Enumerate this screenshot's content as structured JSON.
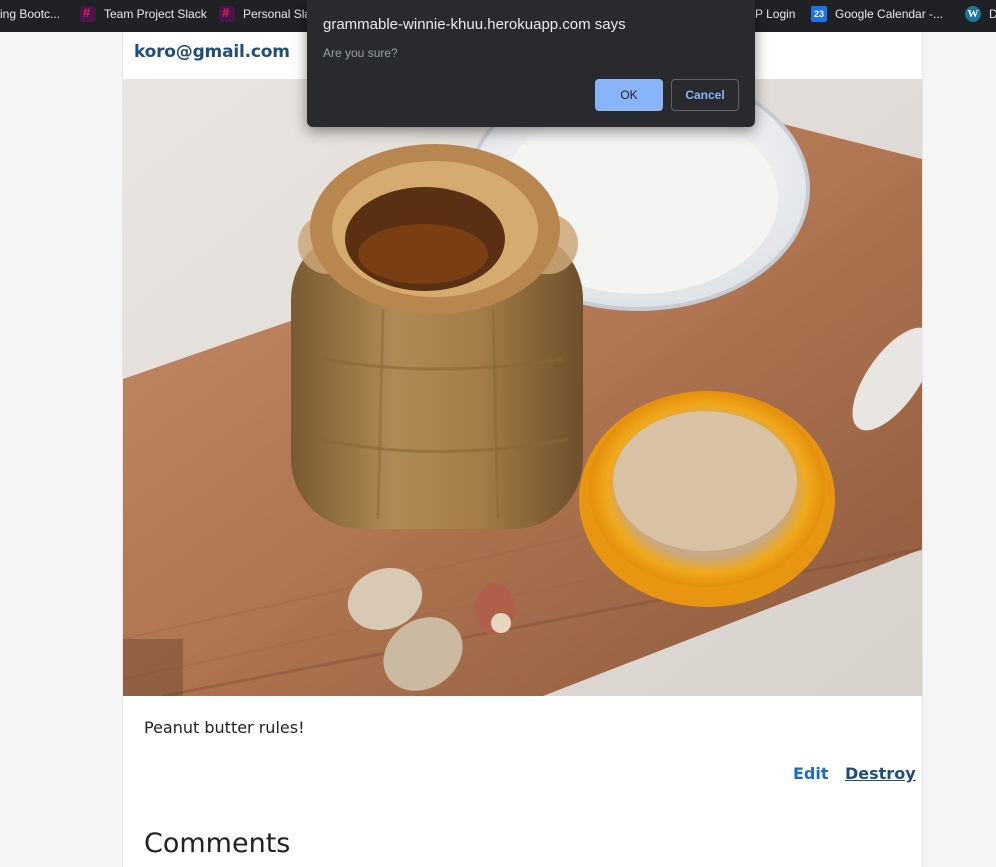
{
  "bookmarks": [
    {
      "label": "ing Bootc...",
      "icon": "none"
    },
    {
      "label": "Team Project Slack",
      "icon": "slack-icon"
    },
    {
      "label": "Personal Sla",
      "icon": "slack-icon"
    },
    {
      "label": "P Login",
      "icon": "none"
    },
    {
      "label": "Google Calendar -...",
      "icon": "google-calendar-icon",
      "icon_text": "23"
    },
    {
      "label": "D",
      "icon": "wordpress-icon",
      "icon_text": "W"
    }
  ],
  "post": {
    "user_email": "koro@gmail.com",
    "image_alt": "Peanut butter jar with cap and peanuts on a wooden cutting board",
    "caption": "Peanut butter rules!",
    "edit_label": "Edit",
    "destroy_label": "Destroy",
    "comments_heading": "Comments"
  },
  "dialog": {
    "title": "grammable-winnie-khuu.herokuapp.com says",
    "message": "Are you sure?",
    "ok_label": "OK",
    "cancel_label": "Cancel"
  },
  "colors": {
    "accent_link": "#1c6cc4",
    "email_text": "#1f4e79",
    "dialog_bg": "#292a2d",
    "ok_button": "#8ab4f8"
  }
}
